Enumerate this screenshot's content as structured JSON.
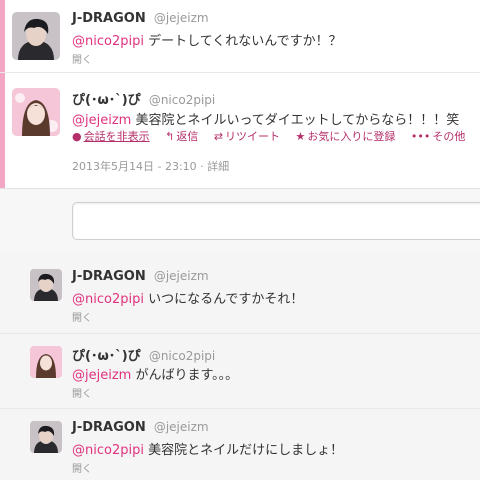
{
  "tweets": [
    {
      "name": "J-DRAGON",
      "handle": "@jejeizm",
      "mention": "@nico2pipi",
      "text": " デートしてくれないんですか！？",
      "expand": "開く"
    },
    {
      "name": "ぴ(･ω･`)ぴ",
      "handle": "@nico2pipi",
      "mention": "@jejeizm",
      "text": " 美容院とネイルいってダイエットしてからなら！！！笑",
      "actions": {
        "hide_conversation": "会話を非表示",
        "reply": "返信",
        "retweet": "リツイート",
        "favorite": "お気に入りに登録",
        "more": "その他"
      },
      "timestamp": "2013年5月14日 - 23:10",
      "details": "詳細"
    },
    {
      "name": "J-DRAGON",
      "handle": "@jejeizm",
      "mention": "@nico2pipi",
      "text": " いつになるんですかそれ！",
      "expand": "開く"
    },
    {
      "name": "ぴ(･ω･`)ぴ",
      "handle": "@nico2pipi",
      "mention": "@jejeizm",
      "text": " がんばります。。。",
      "expand": "開く"
    },
    {
      "name": "J-DRAGON",
      "handle": "@jejeizm",
      "mention": "@nico2pipi",
      "text": " 美容院とネイルだけにしましょ！",
      "expand": "開く"
    }
  ],
  "colors": {
    "mention": "#e0337f",
    "action": "#b5306a",
    "edge": "#f3a6c4"
  },
  "icons": {
    "reply": "reply-arrow-icon",
    "retweet": "retweet-icon",
    "favorite": "star-icon",
    "more": "ellipsis-icon",
    "conversation": "speech-bubble-icon"
  }
}
